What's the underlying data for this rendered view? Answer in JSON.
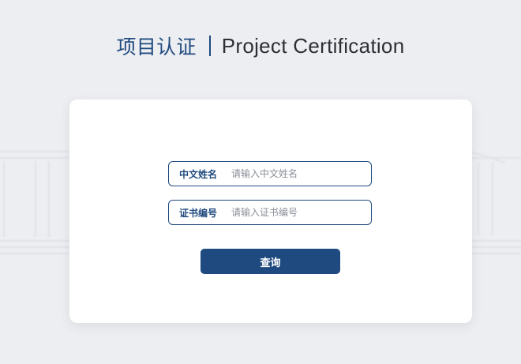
{
  "header": {
    "title_cn": "项目认证",
    "title_en": "Project Certification"
  },
  "form": {
    "name_label": "中文姓名",
    "name_placeholder": "请输入中文姓名",
    "name_value": "",
    "cert_label": "证书编号",
    "cert_placeholder": "请输入证书编号",
    "cert_value": "",
    "query_label": "查询"
  },
  "colors": {
    "brand": "#1f4a7f",
    "background": "#edeef1",
    "card": "#ffffff"
  }
}
